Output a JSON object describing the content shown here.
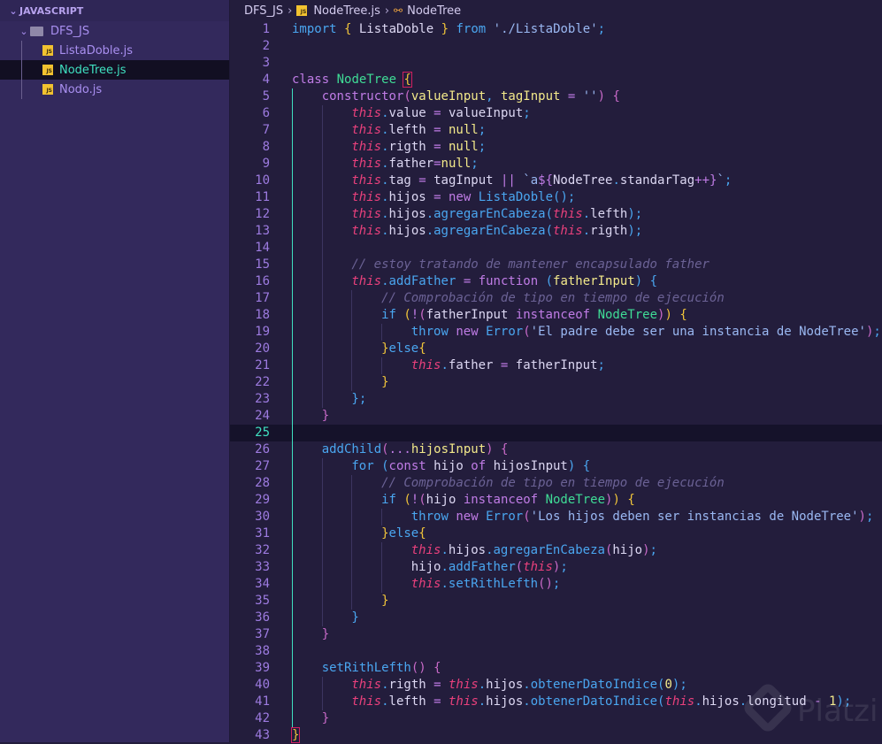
{
  "sidebar": {
    "section": "JAVASCRIPT",
    "folder": "DFS_JS",
    "files": [
      {
        "name": "ListaDoble.js",
        "selected": false
      },
      {
        "name": "NodeTree.js",
        "selected": true
      },
      {
        "name": "Nodo.js",
        "selected": false
      }
    ],
    "file_icon_label": "JS"
  },
  "breadcrumb": {
    "folder": "DFS_JS",
    "file": "NodeTree.js",
    "symbol": "NodeTree"
  },
  "editor": {
    "active_line": 25,
    "watermark": "Platzi",
    "lines": [
      {
        "lv": 0,
        "t": [
          [
            "k",
            "import"
          ],
          [
            "i",
            " "
          ],
          [
            "y",
            "{"
          ],
          [
            "i",
            " ListaDoble "
          ],
          [
            "y",
            "}"
          ],
          [
            "i",
            " "
          ],
          [
            "k",
            "from"
          ],
          [
            "i",
            " "
          ],
          [
            "q",
            "'./ListaDoble'"
          ],
          [
            "u",
            ";"
          ]
        ]
      },
      {
        "lv": 0,
        "t": []
      },
      {
        "lv": 0,
        "t": []
      },
      {
        "lv": 0,
        "t": [
          [
            "s",
            "class"
          ],
          [
            "i",
            " "
          ],
          [
            "c",
            "NodeTree"
          ],
          [
            "i",
            " "
          ],
          [
            "y box",
            "{"
          ]
        ]
      },
      {
        "lv": 1,
        "t": [
          [
            "s",
            "constructor"
          ],
          [
            "r",
            "("
          ],
          [
            "p",
            "valueInput"
          ],
          [
            "u",
            ", "
          ],
          [
            "p",
            "tagInput"
          ],
          [
            "i",
            " "
          ],
          [
            "o",
            "="
          ],
          [
            "i",
            " "
          ],
          [
            "q",
            "''"
          ],
          [
            "r",
            ")"
          ],
          [
            "i",
            " "
          ],
          [
            "r",
            "{"
          ]
        ]
      },
      {
        "lv": 2,
        "t": [
          [
            "t",
            "this"
          ],
          [
            "u",
            "."
          ],
          [
            "i",
            "value "
          ],
          [
            "o",
            "="
          ],
          [
            "i",
            " valueInput"
          ],
          [
            "u",
            ";"
          ]
        ]
      },
      {
        "lv": 2,
        "t": [
          [
            "t",
            "this"
          ],
          [
            "u",
            "."
          ],
          [
            "i",
            "lefth "
          ],
          [
            "o",
            "="
          ],
          [
            "i",
            " "
          ],
          [
            "n",
            "null"
          ],
          [
            "u",
            ";"
          ]
        ]
      },
      {
        "lv": 2,
        "t": [
          [
            "t",
            "this"
          ],
          [
            "u",
            "."
          ],
          [
            "i",
            "rigth "
          ],
          [
            "o",
            "="
          ],
          [
            "i",
            " "
          ],
          [
            "n",
            "null"
          ],
          [
            "u",
            ";"
          ]
        ]
      },
      {
        "lv": 2,
        "t": [
          [
            "t",
            "this"
          ],
          [
            "u",
            "."
          ],
          [
            "i",
            "father"
          ],
          [
            "o",
            "="
          ],
          [
            "n",
            "null"
          ],
          [
            "u",
            ";"
          ]
        ]
      },
      {
        "lv": 2,
        "t": [
          [
            "t",
            "this"
          ],
          [
            "u",
            "."
          ],
          [
            "i",
            "tag "
          ],
          [
            "o",
            "="
          ],
          [
            "i",
            " tagInput "
          ],
          [
            "o",
            "||"
          ],
          [
            "i",
            " "
          ],
          [
            "q",
            "`a"
          ],
          [
            "o",
            "${"
          ],
          [
            "i",
            "NodeTree"
          ],
          [
            "u",
            "."
          ],
          [
            "i",
            "standarTag"
          ],
          [
            "o",
            "++}"
          ],
          [
            "q",
            "`"
          ],
          [
            "u",
            ";"
          ]
        ]
      },
      {
        "lv": 2,
        "t": [
          [
            "t",
            "this"
          ],
          [
            "u",
            "."
          ],
          [
            "i",
            "hijos "
          ],
          [
            "o",
            "="
          ],
          [
            "i",
            " "
          ],
          [
            "s",
            "new"
          ],
          [
            "i",
            " "
          ],
          [
            "f",
            "ListaDoble"
          ],
          [
            "b",
            "()"
          ],
          [
            "u",
            ";"
          ]
        ]
      },
      {
        "lv": 2,
        "t": [
          [
            "t",
            "this"
          ],
          [
            "u",
            "."
          ],
          [
            "i",
            "hijos"
          ],
          [
            "u",
            "."
          ],
          [
            "f",
            "agregarEnCabeza"
          ],
          [
            "b",
            "("
          ],
          [
            "t",
            "this"
          ],
          [
            "u",
            "."
          ],
          [
            "i",
            "lefth"
          ],
          [
            "b",
            ")"
          ],
          [
            "u",
            ";"
          ]
        ]
      },
      {
        "lv": 2,
        "t": [
          [
            "t",
            "this"
          ],
          [
            "u",
            "."
          ],
          [
            "i",
            "hijos"
          ],
          [
            "u",
            "."
          ],
          [
            "f",
            "agregarEnCabeza"
          ],
          [
            "b",
            "("
          ],
          [
            "t",
            "this"
          ],
          [
            "u",
            "."
          ],
          [
            "i",
            "rigth"
          ],
          [
            "b",
            ")"
          ],
          [
            "u",
            ";"
          ]
        ]
      },
      {
        "lv": 2,
        "t": []
      },
      {
        "lv": 2,
        "t": [
          [
            "m",
            "// estoy tratando de mantener encapsulado father"
          ]
        ]
      },
      {
        "lv": 2,
        "t": [
          [
            "t",
            "this"
          ],
          [
            "u",
            "."
          ],
          [
            "f",
            "addFather"
          ],
          [
            "i",
            " "
          ],
          [
            "o",
            "="
          ],
          [
            "i",
            " "
          ],
          [
            "s",
            "function"
          ],
          [
            "i",
            " "
          ],
          [
            "b",
            "("
          ],
          [
            "p",
            "fatherInput"
          ],
          [
            "b",
            ")"
          ],
          [
            "i",
            " "
          ],
          [
            "b",
            "{"
          ]
        ]
      },
      {
        "lv": 3,
        "t": [
          [
            "m",
            "// Comprobación de tipo en tiempo de ejecución"
          ]
        ]
      },
      {
        "lv": 3,
        "t": [
          [
            "k",
            "if"
          ],
          [
            "i",
            " "
          ],
          [
            "y",
            "("
          ],
          [
            "o",
            "!"
          ],
          [
            "r",
            "("
          ],
          [
            "i",
            "fatherInput "
          ],
          [
            "s",
            "instanceof"
          ],
          [
            "i",
            " "
          ],
          [
            "c",
            "NodeTree"
          ],
          [
            "r",
            ")"
          ],
          [
            "y",
            ")"
          ],
          [
            "i",
            " "
          ],
          [
            "y",
            "{"
          ]
        ]
      },
      {
        "lv": 4,
        "t": [
          [
            "k",
            "throw"
          ],
          [
            "i",
            " "
          ],
          [
            "s",
            "new"
          ],
          [
            "i",
            " "
          ],
          [
            "f",
            "Error"
          ],
          [
            "r",
            "("
          ],
          [
            "q",
            "'El padre debe ser una instancia de NodeTree'"
          ],
          [
            "r",
            ")"
          ],
          [
            "u",
            ";"
          ]
        ]
      },
      {
        "lv": 3,
        "t": [
          [
            "y",
            "}"
          ],
          [
            "k",
            "else"
          ],
          [
            "y",
            "{"
          ]
        ]
      },
      {
        "lv": 4,
        "t": [
          [
            "t",
            "this"
          ],
          [
            "u",
            "."
          ],
          [
            "i",
            "father "
          ],
          [
            "o",
            "="
          ],
          [
            "i",
            " fatherInput"
          ],
          [
            "u",
            ";"
          ]
        ]
      },
      {
        "lv": 3,
        "t": [
          [
            "y",
            "}"
          ]
        ]
      },
      {
        "lv": 2,
        "t": [
          [
            "b",
            "}"
          ],
          [
            "u",
            ";"
          ]
        ]
      },
      {
        "lv": 1,
        "t": [
          [
            "r",
            "}"
          ]
        ]
      },
      {
        "lv": 1,
        "t": []
      },
      {
        "lv": 1,
        "t": [
          [
            "f",
            "addChild"
          ],
          [
            "r",
            "("
          ],
          [
            "o",
            "..."
          ],
          [
            "p",
            "hijosInput"
          ],
          [
            "r",
            ")"
          ],
          [
            "i",
            " "
          ],
          [
            "r",
            "{"
          ]
        ]
      },
      {
        "lv": 2,
        "t": [
          [
            "k",
            "for"
          ],
          [
            "i",
            " "
          ],
          [
            "b",
            "("
          ],
          [
            "s",
            "const"
          ],
          [
            "i",
            " hijo "
          ],
          [
            "s",
            "of"
          ],
          [
            "i",
            " hijosInput"
          ],
          [
            "b",
            ")"
          ],
          [
            "i",
            " "
          ],
          [
            "b",
            "{"
          ]
        ]
      },
      {
        "lv": 3,
        "t": [
          [
            "m",
            "// Comprobación de tipo en tiempo de ejecución"
          ]
        ]
      },
      {
        "lv": 3,
        "t": [
          [
            "k",
            "if"
          ],
          [
            "i",
            " "
          ],
          [
            "y",
            "("
          ],
          [
            "o",
            "!"
          ],
          [
            "r",
            "("
          ],
          [
            "i",
            "hijo "
          ],
          [
            "s",
            "instanceof"
          ],
          [
            "i",
            " "
          ],
          [
            "c",
            "NodeTree"
          ],
          [
            "r",
            ")"
          ],
          [
            "y",
            ")"
          ],
          [
            "i",
            " "
          ],
          [
            "y",
            "{"
          ]
        ]
      },
      {
        "lv": 4,
        "t": [
          [
            "k",
            "throw"
          ],
          [
            "i",
            " "
          ],
          [
            "s",
            "new"
          ],
          [
            "i",
            " "
          ],
          [
            "f",
            "Error"
          ],
          [
            "r",
            "("
          ],
          [
            "q",
            "'Los hijos deben ser instancias de NodeTree'"
          ],
          [
            "r",
            ")"
          ],
          [
            "u",
            ";"
          ]
        ]
      },
      {
        "lv": 3,
        "t": [
          [
            "y",
            "}"
          ],
          [
            "k",
            "else"
          ],
          [
            "y",
            "{"
          ]
        ]
      },
      {
        "lv": 4,
        "t": [
          [
            "t",
            "this"
          ],
          [
            "u",
            "."
          ],
          [
            "i",
            "hijos"
          ],
          [
            "u",
            "."
          ],
          [
            "f",
            "agregarEnCabeza"
          ],
          [
            "r",
            "("
          ],
          [
            "i",
            "hijo"
          ],
          [
            "r",
            ")"
          ],
          [
            "u",
            ";"
          ]
        ]
      },
      {
        "lv": 4,
        "t": [
          [
            "i",
            "hijo"
          ],
          [
            "u",
            "."
          ],
          [
            "f",
            "addFather"
          ],
          [
            "r",
            "("
          ],
          [
            "t",
            "this"
          ],
          [
            "r",
            ")"
          ],
          [
            "u",
            ";"
          ]
        ]
      },
      {
        "lv": 4,
        "t": [
          [
            "t",
            "this"
          ],
          [
            "u",
            "."
          ],
          [
            "f",
            "setRithLefth"
          ],
          [
            "r",
            "()"
          ],
          [
            "u",
            ";"
          ]
        ]
      },
      {
        "lv": 3,
        "t": [
          [
            "y",
            "}"
          ]
        ]
      },
      {
        "lv": 2,
        "t": [
          [
            "b",
            "}"
          ]
        ]
      },
      {
        "lv": 1,
        "t": [
          [
            "r",
            "}"
          ]
        ]
      },
      {
        "lv": 1,
        "t": []
      },
      {
        "lv": 1,
        "t": [
          [
            "f",
            "setRithLefth"
          ],
          [
            "r",
            "()"
          ],
          [
            "i",
            " "
          ],
          [
            "r",
            "{"
          ]
        ]
      },
      {
        "lv": 2,
        "t": [
          [
            "t",
            "this"
          ],
          [
            "u",
            "."
          ],
          [
            "i",
            "rigth "
          ],
          [
            "o",
            "="
          ],
          [
            "i",
            " "
          ],
          [
            "t",
            "this"
          ],
          [
            "u",
            "."
          ],
          [
            "i",
            "hijos"
          ],
          [
            "u",
            "."
          ],
          [
            "f",
            "obtenerDatoIndice"
          ],
          [
            "b",
            "("
          ],
          [
            "n",
            "0"
          ],
          [
            "b",
            ")"
          ],
          [
            "u",
            ";"
          ]
        ]
      },
      {
        "lv": 2,
        "t": [
          [
            "t",
            "this"
          ],
          [
            "u",
            "."
          ],
          [
            "i",
            "lefth "
          ],
          [
            "o",
            "="
          ],
          [
            "i",
            " "
          ],
          [
            "t",
            "this"
          ],
          [
            "u",
            "."
          ],
          [
            "i",
            "hijos"
          ],
          [
            "u",
            "."
          ],
          [
            "f",
            "obtenerDatoIndice"
          ],
          [
            "b",
            "("
          ],
          [
            "t",
            "this"
          ],
          [
            "u",
            "."
          ],
          [
            "i",
            "hijos"
          ],
          [
            "u",
            "."
          ],
          [
            "i",
            "longitud "
          ],
          [
            "o",
            "-"
          ],
          [
            "i",
            " "
          ],
          [
            "n",
            "1"
          ],
          [
            "b",
            ")"
          ],
          [
            "u",
            ";"
          ]
        ]
      },
      {
        "lv": 1,
        "t": [
          [
            "r",
            "}"
          ]
        ]
      },
      {
        "lv": 0,
        "t": [
          [
            "y box",
            "}"
          ]
        ]
      }
    ]
  }
}
